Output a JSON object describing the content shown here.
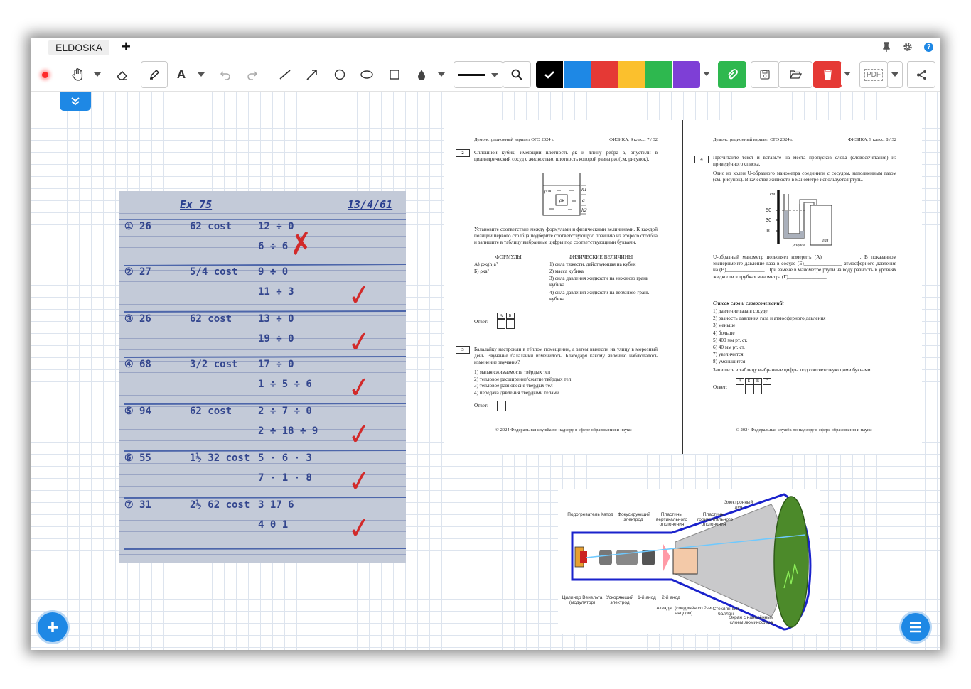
{
  "app": {
    "tab_name": "ELDOSKA",
    "add_tab": "+"
  },
  "toolbar": {
    "colors": [
      "#000000",
      "#1e88e5",
      "#e53935",
      "#fbc02d",
      "#2eb84f",
      "#7e3fd6"
    ],
    "accent": "#1e88e5",
    "icons": [
      "record-icon",
      "hand-icon",
      "eraser-icon",
      "pencil-icon",
      "text-icon",
      "undo-icon",
      "redo-icon",
      "line-icon",
      "arrow-icon",
      "circle-icon",
      "ellipse-icon",
      "rectangle-icon",
      "fill-icon",
      "zoom-icon",
      "check-icon",
      "attach-icon",
      "save-icon",
      "open-folder-icon",
      "trash-icon",
      "pdf-icon",
      "share-icon"
    ],
    "pdf_label": "PDF"
  },
  "notebook": {
    "header": "Ex 75",
    "date": "13/4/61",
    "rows": [
      {
        "n": "① 26",
        "a": "62 cost",
        "b": "12 ÷ 0",
        "c": "6 ÷ 6",
        "mark": "✗"
      },
      {
        "n": "② 27",
        "a": "5/4 cost",
        "b": "9 ÷ 0",
        "c": "11 ÷ 3",
        "mark": "✓"
      },
      {
        "n": "③ 26",
        "a": "62 cost",
        "b": "13 ÷ 0",
        "c": "19 ÷ 0",
        "mark": "✓"
      },
      {
        "n": "④ 68",
        "a": "3/2 cost",
        "b": "17 ÷ 0",
        "c": "1 ÷ 5 ÷ 6",
        "mark": "✓"
      },
      {
        "n": "⑤ 94",
        "a": "62 cost",
        "b": "2 ÷ 7 ÷ 0",
        "c": "2 ÷ 18 ÷ 9",
        "mark": "✓"
      },
      {
        "n": "⑥ 55",
        "a": "1½ 32 cost",
        "b": "5 · 6 · 3",
        "c": "7 · 1 · 8",
        "mark": "✓"
      },
      {
        "n": "⑦ 31",
        "a": "2½ 62 cost",
        "b": "3 17 6",
        "c": "4 0 1",
        "mark": "✓"
      }
    ]
  },
  "exam": {
    "left": {
      "header_left": "Демонстрационный вариант ОГЭ 2024 г.",
      "header_right": "ФИЗИКА, 9 класс.     7 / 32",
      "q2_num": "2",
      "q2_text": "Сплошной кубик, имеющий плотность ρк и длину ребра a, опустили в цилиндрический сосуд с жидкостью, плотность которой равна ρж (см. рисунок).",
      "q2_fig": [
        "ρж",
        "ρк",
        "h1",
        "a",
        "h2"
      ],
      "q2_instr": "Установите соответствие между формулами и физическими величинами. К каждой позиции первого столбца подберите соответствующую позицию из второго столбца и запишите в таблицу выбранные цифры под соответствующими буквами.",
      "formulas_title": "ФОРМУЛЫ",
      "quantities_title": "ФИЗИЧЕСКИЕ ВЕЛИЧИНЫ",
      "formulas": [
        "А)  ρжgh₁a²",
        "Б)  ρкa³"
      ],
      "quantities": [
        "1)  сила тяжести, действующая на кубик",
        "2)  масса кубика",
        "3)  сила давления жидкости на нижнюю грань кубика",
        "4)  сила давления жидкости на верхнюю грань кубика"
      ],
      "answer_label": "Ответ:",
      "answer_cols": [
        "А",
        "Б"
      ],
      "q3_num": "3",
      "q3_text": "Балалайку настроили в тёплом помещении, а затем вынесли на улицу в морозный день. Звучание балалайки изменилось. Благодаря какому явлению наблюдалось изменение звучания?",
      "q3_options": [
        "1)  малая сжимаемость твёрдых тел",
        "2)  тепловое расширение/сжатие твёрдых тел",
        "3)  тепловое равновесие твёрдых тел",
        "4)  передача давления твёрдыми телами"
      ],
      "footer": "© 2024 Федеральная служба по надзору в сфере образования и науки"
    },
    "right": {
      "header_left": "Демонстрационный вариант ОГЭ 2024 г.",
      "header_right": "ФИЗИКА, 9 класс.     8 / 32",
      "q4_num": "4",
      "q4_text": "Прочитайте текст и вставьте на места пропусков слова (словосочетания) из приведённого списка.",
      "q4_intro": "Одно из колен U-образного манометра соединили с сосудом, наполненным газом (см. рисунок). В качестве жидкости в манометре используется ртуть.",
      "fig_unit": "см",
      "fig_ticks": [
        "50",
        "30",
        "10"
      ],
      "fig_labels": [
        "ртуть",
        "газ"
      ],
      "q4_body": "U-образный манометр позволяет измерить (А)_______________. В показанном эксперименте давление газа в сосуде (Б)_______________ атмосферного давления на (В)_______________. При замене в манометре ртути на воду разность в уровнях жидкости в трубках манометра (Г)_______________.",
      "list_title": "Список слов и словосочетаний:",
      "list": [
        "1)  давление газа в сосуде",
        "2)  разность давления газа и атмосферного давления",
        "3)  меньше",
        "4)  больше",
        "5)  400 мм рт. ст.",
        "6)  40 мм рт. ст.",
        "7)  увеличится",
        "8)  уменьшится"
      ],
      "list_instr": "Запишите в таблицу выбранные цифры под соответствующими буквами.",
      "answer_label": "Ответ:",
      "answer_cols": [
        "А",
        "Б",
        "В",
        "Г"
      ],
      "footer": "© 2024 Федеральная служба по надзору в сфере образования и науки"
    }
  },
  "crt": {
    "labels": {
      "heater": "Подогреватель",
      "cathode": "Катод",
      "focus": "Фокусирующий электрод",
      "vplates": "Пластины вертикального отклонения",
      "hplates": "Пластины горизонтального отклонения",
      "beam": "Электронный луч",
      "wehnelt": "Цилиндр Венельта (модулятор)",
      "accel": "Ускоряющий электрод",
      "anode1": "1-й анод",
      "anode2": "2-й анод",
      "aquadag": "Аквадаг (соединён со 2-м анодом)",
      "bulb": "Стеклянный баллон",
      "screen": "Экран с нанесённым слоем люминофора"
    }
  }
}
